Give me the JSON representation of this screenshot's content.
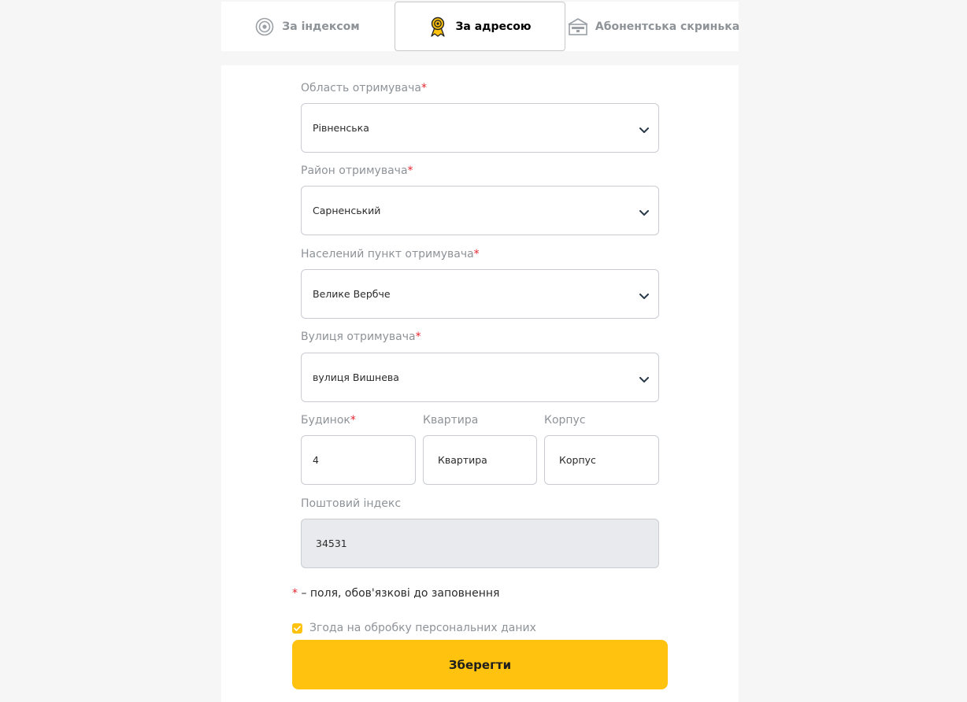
{
  "tabs": {
    "index": {
      "label": "За індексом",
      "icon": "target-icon"
    },
    "address": {
      "label": "За адресою",
      "icon": "location-marker-icon"
    },
    "box": {
      "label": "Абонентська скринька",
      "icon": "mailbox-icon"
    }
  },
  "form": {
    "required_mark": "*",
    "region": {
      "label": "Область отримувача",
      "value": "Рівненська"
    },
    "district": {
      "label": "Район отримувача",
      "value": "Сарненський"
    },
    "settlement": {
      "label": "Населений пункт отримувача",
      "value": "Велике Вербче"
    },
    "street": {
      "label": "Вулиця отримувача",
      "value": "вулиця Вишнева"
    },
    "house": {
      "label": "Будинок",
      "value": "4"
    },
    "apartment": {
      "label": "Квартира",
      "placeholder": "Квартира"
    },
    "building": {
      "label": "Корпус",
      "placeholder": "Корпус"
    },
    "postcode": {
      "label": "Поштовий індекс",
      "value": "34531"
    },
    "required_note": "– поля, обов'язкові до заповнення",
    "consent": {
      "label": "Згода на обробку персональних даних",
      "checked": true
    },
    "save_label": "Зберегти"
  },
  "colors": {
    "accent": "#ffc20e",
    "required": "#e3262f",
    "muted_text": "#8e9398",
    "readonly_bg": "#e8eaed"
  }
}
